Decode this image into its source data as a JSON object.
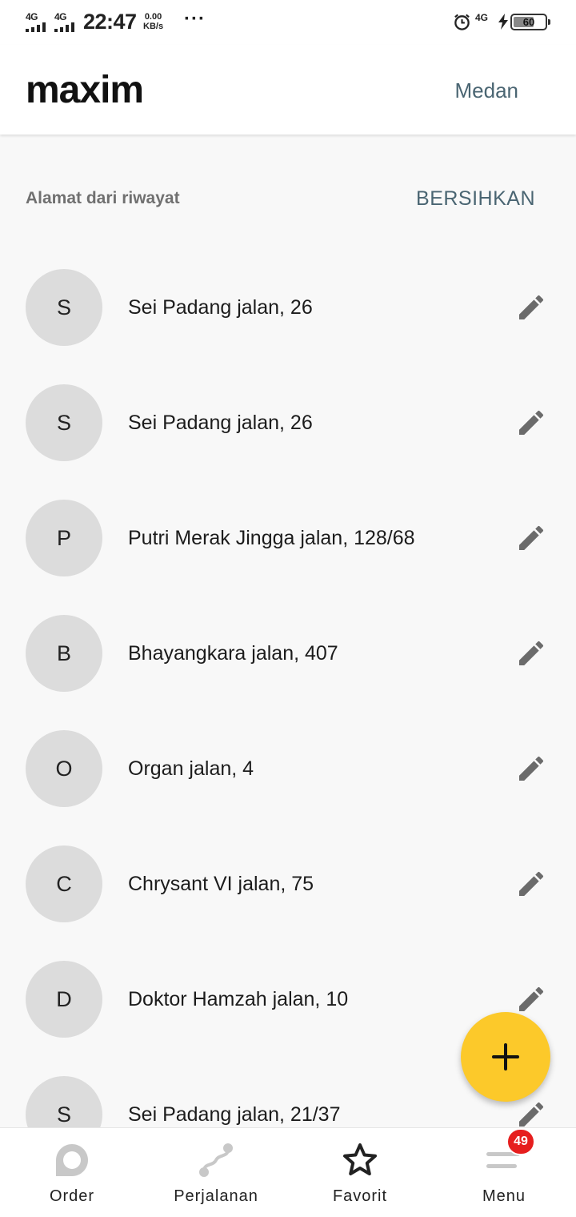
{
  "status_bar": {
    "sim1": "4G",
    "sim2": "4G",
    "time": "22:47",
    "speed_value": "0.00",
    "speed_unit": "KB/s",
    "more": "···",
    "network_right": "4G",
    "battery": "60"
  },
  "header": {
    "logo_text": "maxim",
    "city": "Medan"
  },
  "section": {
    "title": "Alamat dari riwayat",
    "clear_label": "BERSIHKAN"
  },
  "addresses": [
    {
      "initial": "S",
      "text": "Sei Padang jalan, 26"
    },
    {
      "initial": "S",
      "text": "Sei Padang jalan, 26"
    },
    {
      "initial": "P",
      "text": "Putri Merak Jingga jalan, 128/68"
    },
    {
      "initial": "B",
      "text": "Bhayangkara jalan, 407"
    },
    {
      "initial": "O",
      "text": "Organ jalan, 4"
    },
    {
      "initial": "C",
      "text": "Chrysant VI jalan, 75"
    },
    {
      "initial": "D",
      "text": "Doktor Hamzah jalan, 10"
    },
    {
      "initial": "S",
      "text": "Sei Padang jalan, 21/37"
    }
  ],
  "fab": {
    "icon": "plus-icon"
  },
  "bottom_nav": {
    "items": [
      {
        "label": "Order",
        "icon": "order-icon"
      },
      {
        "label": "Perjalanan",
        "icon": "route-icon"
      },
      {
        "label": "Favorit",
        "icon": "star-icon"
      },
      {
        "label": "Menu",
        "icon": "menu-icon"
      }
    ],
    "menu_badge": "49"
  },
  "colors": {
    "accent": "#fcc92a",
    "link": "#4a6572",
    "badge": "#e61e1e",
    "brand_red": "#e4232b"
  }
}
